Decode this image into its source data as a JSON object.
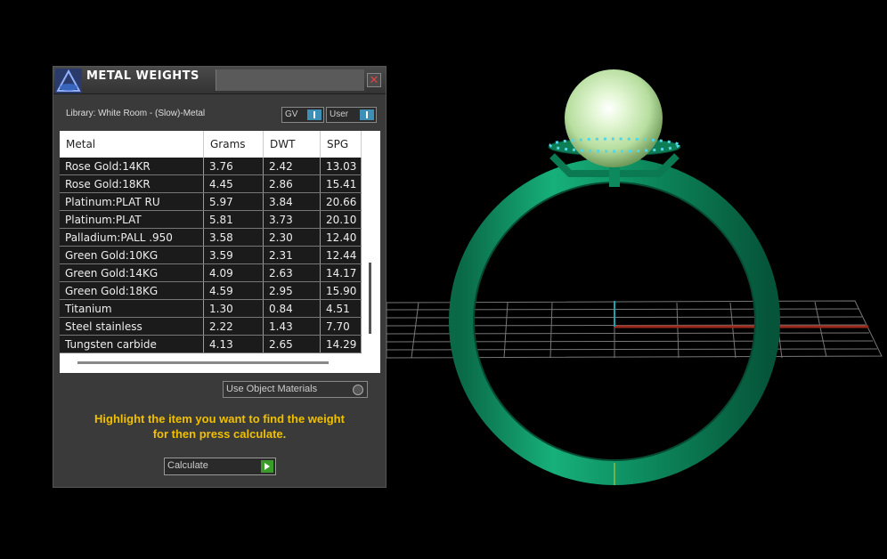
{
  "window": {
    "title": "METAL WEIGHTS",
    "library": "Library: White Room - (Slow)-Metal",
    "toggles": [
      {
        "label": "GV"
      },
      {
        "label": "User"
      }
    ]
  },
  "table": {
    "headers": [
      "Metal",
      "Grams",
      "DWT",
      "SPG"
    ],
    "rows": [
      [
        "Rose Gold:14KR",
        "3.76",
        "2.42",
        "13.03"
      ],
      [
        "Rose Gold:18KR",
        "4.45",
        "2.86",
        "15.41"
      ],
      [
        "Platinum:PLAT RU",
        "5.97",
        "3.84",
        "20.66"
      ],
      [
        "Platinum:PLAT",
        "5.81",
        "3.73",
        "20.10"
      ],
      [
        "Palladium:PALL .950",
        "3.58",
        "2.30",
        "12.40"
      ],
      [
        "Green Gold:10KG",
        "3.59",
        "2.31",
        "12.44"
      ],
      [
        "Green Gold:14KG",
        "4.09",
        "2.63",
        "14.17"
      ],
      [
        "Green Gold:18KG",
        "4.59",
        "2.95",
        "15.90"
      ],
      [
        "Titanium",
        "1.30",
        "0.84",
        "4.51"
      ],
      [
        "Steel stainless",
        "2.22",
        "1.43",
        "7.70"
      ],
      [
        "Tungsten carbide",
        "4.13",
        "2.65",
        "14.29"
      ]
    ]
  },
  "options": {
    "use_object_materials": "Use Object Materials"
  },
  "hint": {
    "line1": "Highlight the item you want to find the weight",
    "line2": "for then press calculate."
  },
  "calculate_label": "Calculate",
  "colors": {
    "ring": "#0f8a5f",
    "pearl": "#cdeebd",
    "hint": "#f0c000",
    "grid": "#8a8a8a"
  }
}
